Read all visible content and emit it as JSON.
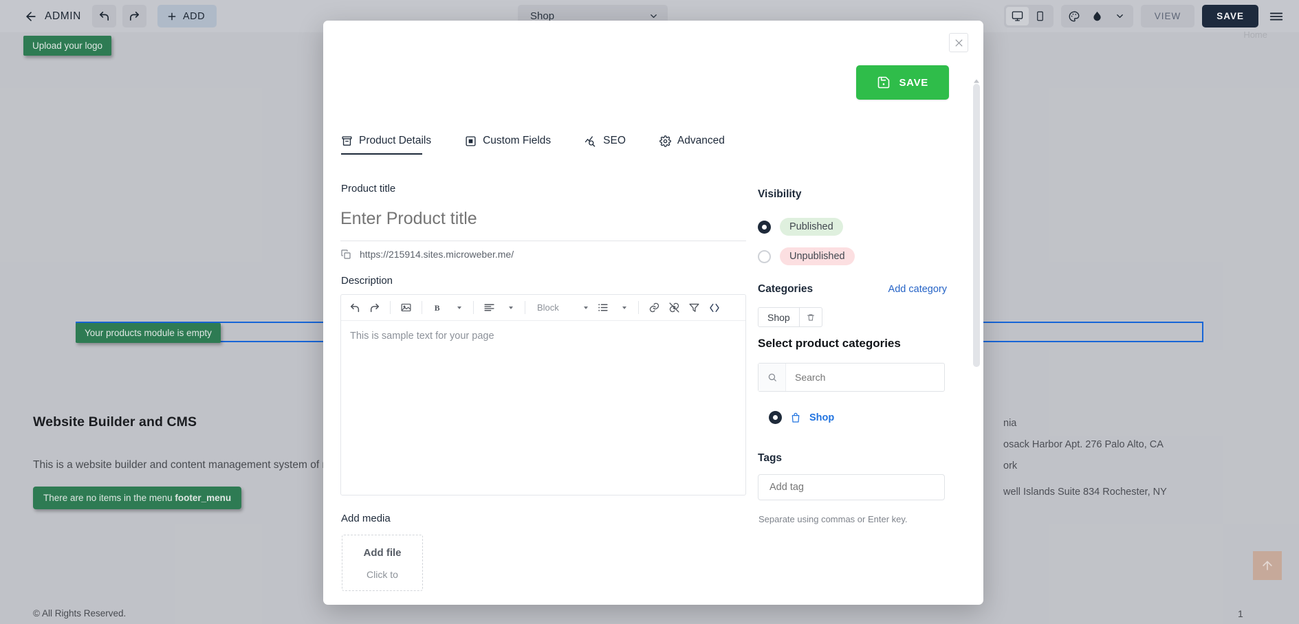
{
  "admin_bar": {
    "back_label": "",
    "admin_label": "ADMIN",
    "undo_label": "",
    "redo_label": "",
    "add_label": "ADD",
    "page_select_value": "Shop",
    "view_label": "VIEW",
    "save_label": "SAVE"
  },
  "site": {
    "tooltip_logo": "Upload your logo",
    "tooltip_products": "Your products module is empty",
    "tooltip_footer_prefix": "There are no items in the menu ",
    "tooltip_footer_menu": "footer_menu",
    "heading": "Website Builder and CMS",
    "paragraph": "This is a website builder and content management system of new gener",
    "copyright": "© All Rights Reserved.",
    "home_link": "Home",
    "page_number": "1",
    "addresses": [
      "nia",
      "osack Harbor Apt. 276 Palo Alto, CA",
      "ork",
      "well Islands Suite 834 Rochester, NY"
    ]
  },
  "modal": {
    "close_label": "",
    "save_label": "SAVE",
    "tabs": [
      {
        "label": "Product Details",
        "icon": "archive-icon",
        "active": true
      },
      {
        "label": "Custom Fields",
        "icon": "custom-fields-icon",
        "active": false
      },
      {
        "label": "SEO",
        "icon": "seo-chart-icon",
        "active": false
      },
      {
        "label": "Advanced",
        "icon": "gear-icon",
        "active": false
      }
    ],
    "product_title": {
      "label": "Product title",
      "value": "",
      "placeholder": "Enter Product title",
      "url": "https://215914.sites.microweber.me/"
    },
    "description": {
      "label": "Description",
      "body_text": "This is sample text for your page",
      "toolbar": {
        "block_label": "Block"
      }
    },
    "add_media": {
      "label": "Add media",
      "dropzone_title": "Add file",
      "dropzone_sub": "Click to"
    },
    "visibility": {
      "title": "Visibility",
      "options": [
        {
          "label": "Published",
          "selected": true
        },
        {
          "label": "Unpublished",
          "selected": false
        }
      ]
    },
    "categories": {
      "title": "Categories",
      "add_link": "Add category",
      "chip_label": "Shop",
      "select_title": "Select product categories",
      "search_placeholder": "Search",
      "search_value": "",
      "option_label": "Shop"
    },
    "tags": {
      "title": "Tags",
      "placeholder": "Add tag",
      "value": "",
      "hint": "Separate using commas or Enter key."
    }
  },
  "colors": {
    "green_save": "#2fbd4a",
    "dark_save": "#1d2b3e",
    "accent_blue": "#2274e0",
    "published_badge": "#dff0de",
    "unpublished_badge": "#fcdfe1",
    "tooltip_green": "#2f8055"
  }
}
